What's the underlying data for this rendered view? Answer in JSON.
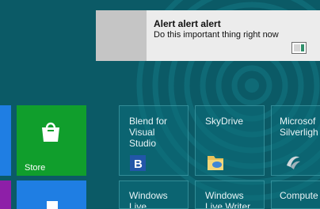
{
  "colors": {
    "start_background": "#0b5a66",
    "store_tile": "#109e2c",
    "blue_tile": "#1f7ee3",
    "purple_tile": "#8e1fa8",
    "toast_background": "#ececec",
    "toast_logo": "#c5c5c5"
  },
  "toast": {
    "title": "Alert alert alert",
    "message": "Do this important thing right now",
    "logo_icon": "app-logo-placeholder",
    "app_icon": "app-window-icon"
  },
  "tiles": {
    "store": {
      "label": "Store",
      "icon": "shopping-bag-icon"
    },
    "blend": {
      "label": "Blend for\nVisual\nStudio",
      "icon": "blend-logo-icon"
    },
    "skydrive": {
      "label": "SkyDrive",
      "icon": "folder-icon"
    },
    "silverlight": {
      "label": "Microsof\nSilverligh",
      "icon": "silverlight-icon"
    },
    "live_mail": {
      "label": "Windows\nLive"
    },
    "live_writer": {
      "label": "Windows\nLive Writer"
    },
    "compute": {
      "label": "Compute"
    }
  }
}
